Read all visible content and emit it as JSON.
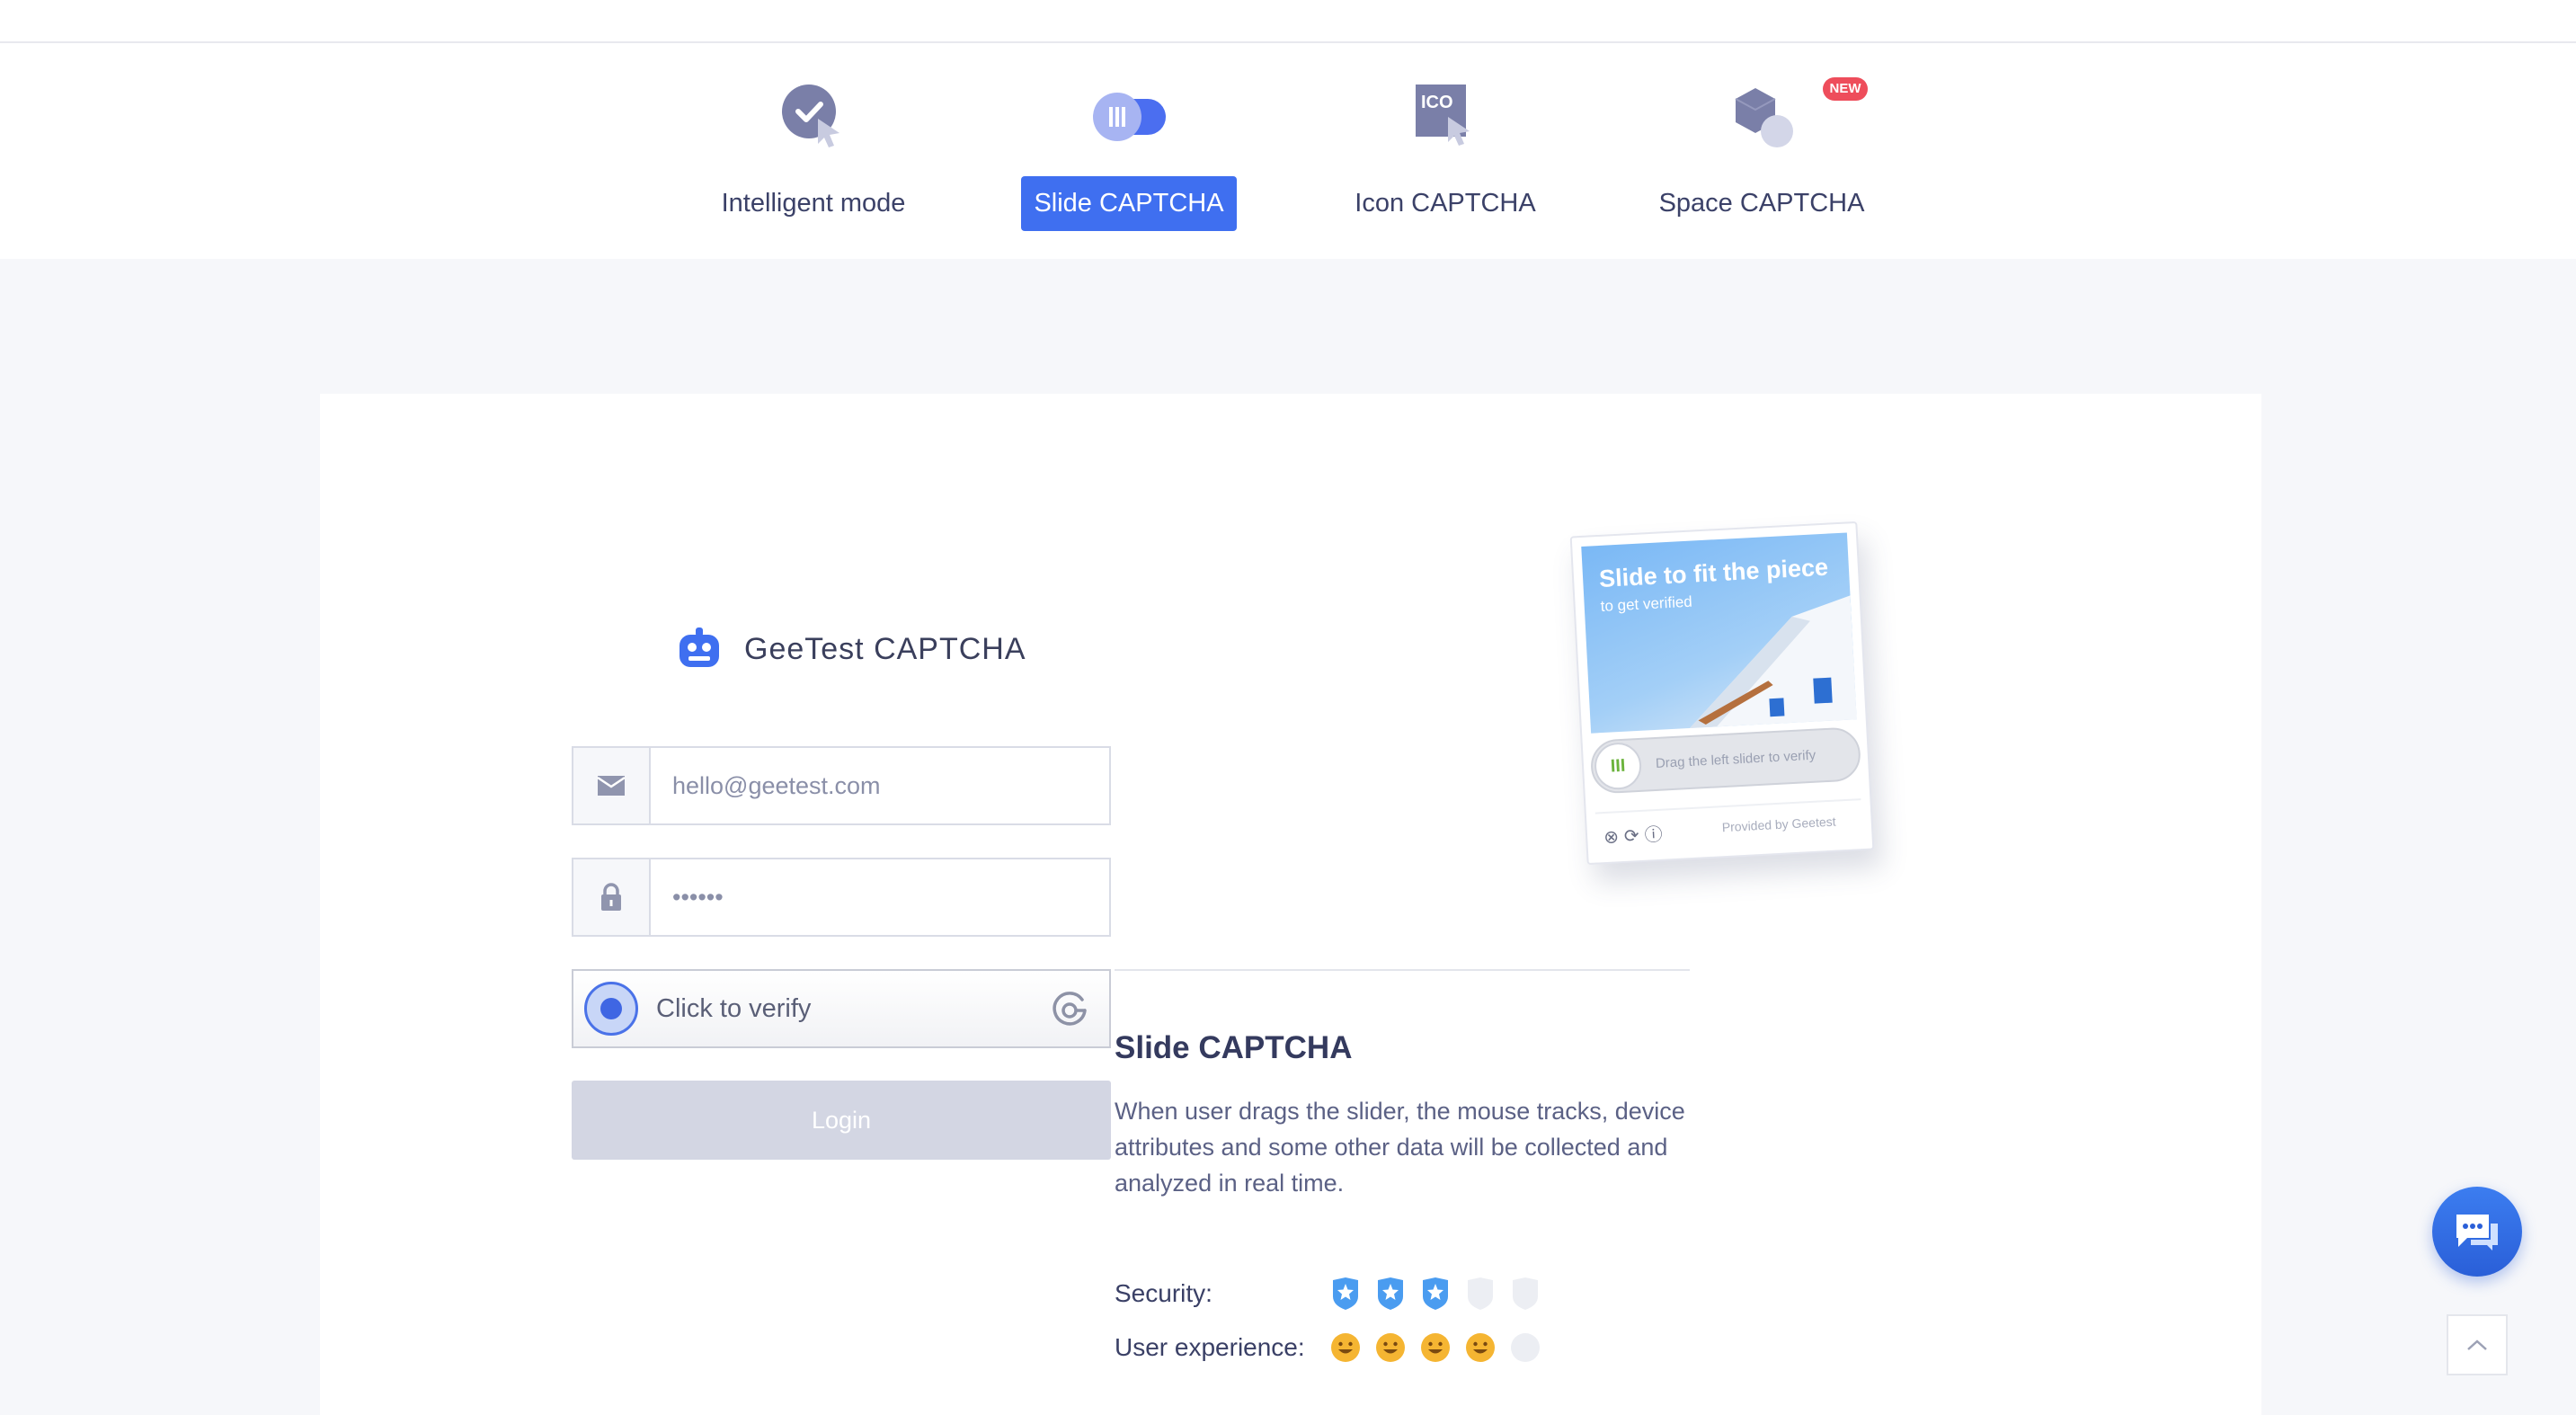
{
  "tabs": [
    {
      "label": "Intelligent mode",
      "icon": "check-cursor-icon",
      "active": false
    },
    {
      "label": "Slide CAPTCHA",
      "icon": "slider-toggle-icon",
      "active": true
    },
    {
      "label": "Icon CAPTCHA",
      "icon": "ico-cursor-icon",
      "active": false
    },
    {
      "label": "Space CAPTCHA",
      "icon": "cube-sphere-icon",
      "active": false,
      "badge": "NEW"
    }
  ],
  "brand": {
    "name": "GeeTest CAPTCHA",
    "icon": "robot-icon"
  },
  "form": {
    "email_placeholder": "hello@geetest.com",
    "password_value": "••••••",
    "verify_label": "Click to verify",
    "login_label": "Login"
  },
  "preview": {
    "title": "Slide to fit the piece",
    "subtitle": "to get verified",
    "slider_hint": "Drag the left slider to verify",
    "provider": "Provided by Geetest"
  },
  "description": {
    "title": "Slide CAPTCHA",
    "text": "When user drags the slider, the mouse tracks, device attributes and some other data will be collected and analyzed in real time."
  },
  "ratings": [
    {
      "label": "Security:",
      "value": 3,
      "max": 5,
      "icon": "shield-star-icon"
    },
    {
      "label": "User experience:",
      "value": 4,
      "max": 5,
      "icon": "smile-icon"
    }
  ],
  "colors": {
    "accent": "#3f6ff0",
    "badge": "#ee4d5b",
    "shield_active": "#4a9cf0",
    "smile_active": "#f5b532",
    "inactive": "#eceef3"
  }
}
